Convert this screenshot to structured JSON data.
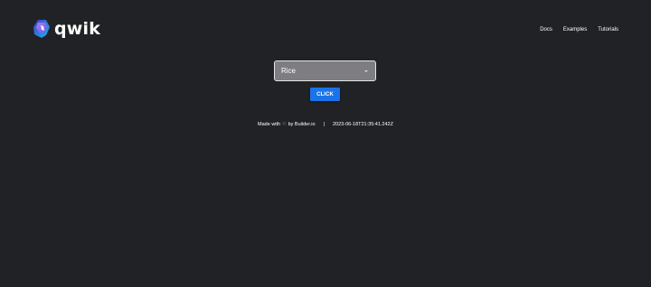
{
  "header": {
    "logo_text": "qwik",
    "nav": [
      {
        "label": "Docs"
      },
      {
        "label": "Examples"
      },
      {
        "label": "Tutorials"
      }
    ]
  },
  "main": {
    "select": {
      "value": "Rice"
    },
    "button_label": "CLICK"
  },
  "footer": {
    "made_prefix": "Made with",
    "heart_icon": "♡",
    "made_suffix": "by Builder.io",
    "separator": "|",
    "timestamp": "2023-06-18T21:35:41.242Z"
  },
  "colors": {
    "background": "#212226",
    "button": "#1a73e8",
    "select_bg": "#7e7e82",
    "logo_blue": "#18b6f6",
    "logo_purple": "#ac7ef4"
  }
}
